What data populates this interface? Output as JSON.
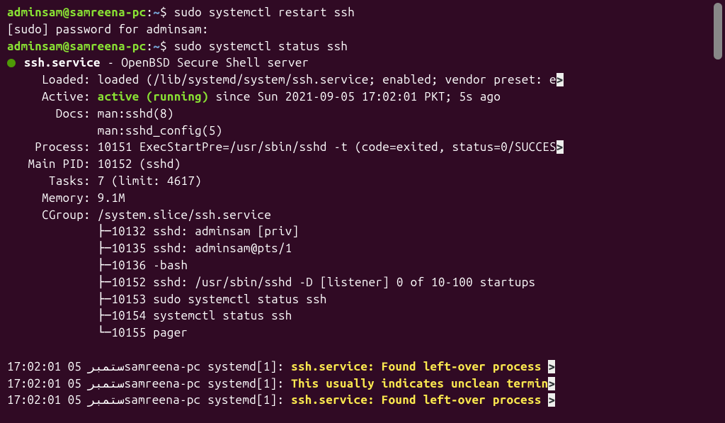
{
  "prompt": {
    "user_host": "adminsam@samreena-pc",
    "sep": ":",
    "path": "~",
    "dollar": "$"
  },
  "commands": {
    "restart": "sudo systemctl restart ssh",
    "status": "sudo systemctl status ssh"
  },
  "sudo_prompt": "[sudo] password for adminsam:",
  "service": {
    "name": "ssh.service",
    "desc": " - OpenBSD Secure Shell server"
  },
  "status": {
    "loaded_label": "     Loaded: ",
    "loaded_value": "loaded (/lib/systemd/system/ssh.service; enabled; vendor preset: e",
    "loaded_trunc": ">",
    "active_label": "     Active: ",
    "active_state": "active (running)",
    "active_since": " since Sun 2021-09-05 17:02:01 PKT; 5s ago",
    "docs_label": "       Docs: ",
    "docs1": "man:sshd(8)",
    "docs2_pad": "             ",
    "docs2": "man:sshd_config(5)",
    "process_label": "    Process: ",
    "process_value": "10151 ExecStartPre=/usr/sbin/sshd -t (code=exited, status=0/SUCCES",
    "process_trunc": ">",
    "mainpid_label": "   Main PID: ",
    "mainpid_value": "10152 (sshd)",
    "tasks_label": "      Tasks: ",
    "tasks_value": "7 (limit: 4617)",
    "memory_label": "     Memory: ",
    "memory_value": "9.1M",
    "cgroup_label": "     CGroup: ",
    "cgroup_value": "/system.slice/ssh.service"
  },
  "tree": {
    "prefix_mid": "             ├─",
    "prefix_last": "             └─",
    "p1": "10132 sshd: adminsam [priv]",
    "p2": "10135 sshd: adminsam@pts/1",
    "p3": "10136 -bash",
    "p4": "10152 sshd: /usr/sbin/sshd -D [listener] 0 of 10-100 startups",
    "p5": "10153 sudo systemctl status ssh",
    "p6": "10154 systemctl status ssh",
    "p7": "10155 pager"
  },
  "log": {
    "l1_time": "17:02:01 05 ",
    "l1_arabic": "ستمبر",
    "l1_mid": "samreena-pc systemd[1]: ",
    "l1_msg": "ssh.service: Found left-over process ",
    "l1_trunc": ">",
    "l2_time": "17:02:01 05 ",
    "l2_arabic": "ستمبر",
    "l2_mid": "samreena-pc systemd[1]: ",
    "l2_msg": "This usually indicates unclean termin",
    "l2_trunc": ">",
    "l3_time": "17:02:01 05 ",
    "l3_arabic": "ستمبر",
    "l3_mid": "samreena-pc systemd[1]: ",
    "l3_msg": "ssh.service: Found left-over process ",
    "l3_trunc": ">"
  }
}
